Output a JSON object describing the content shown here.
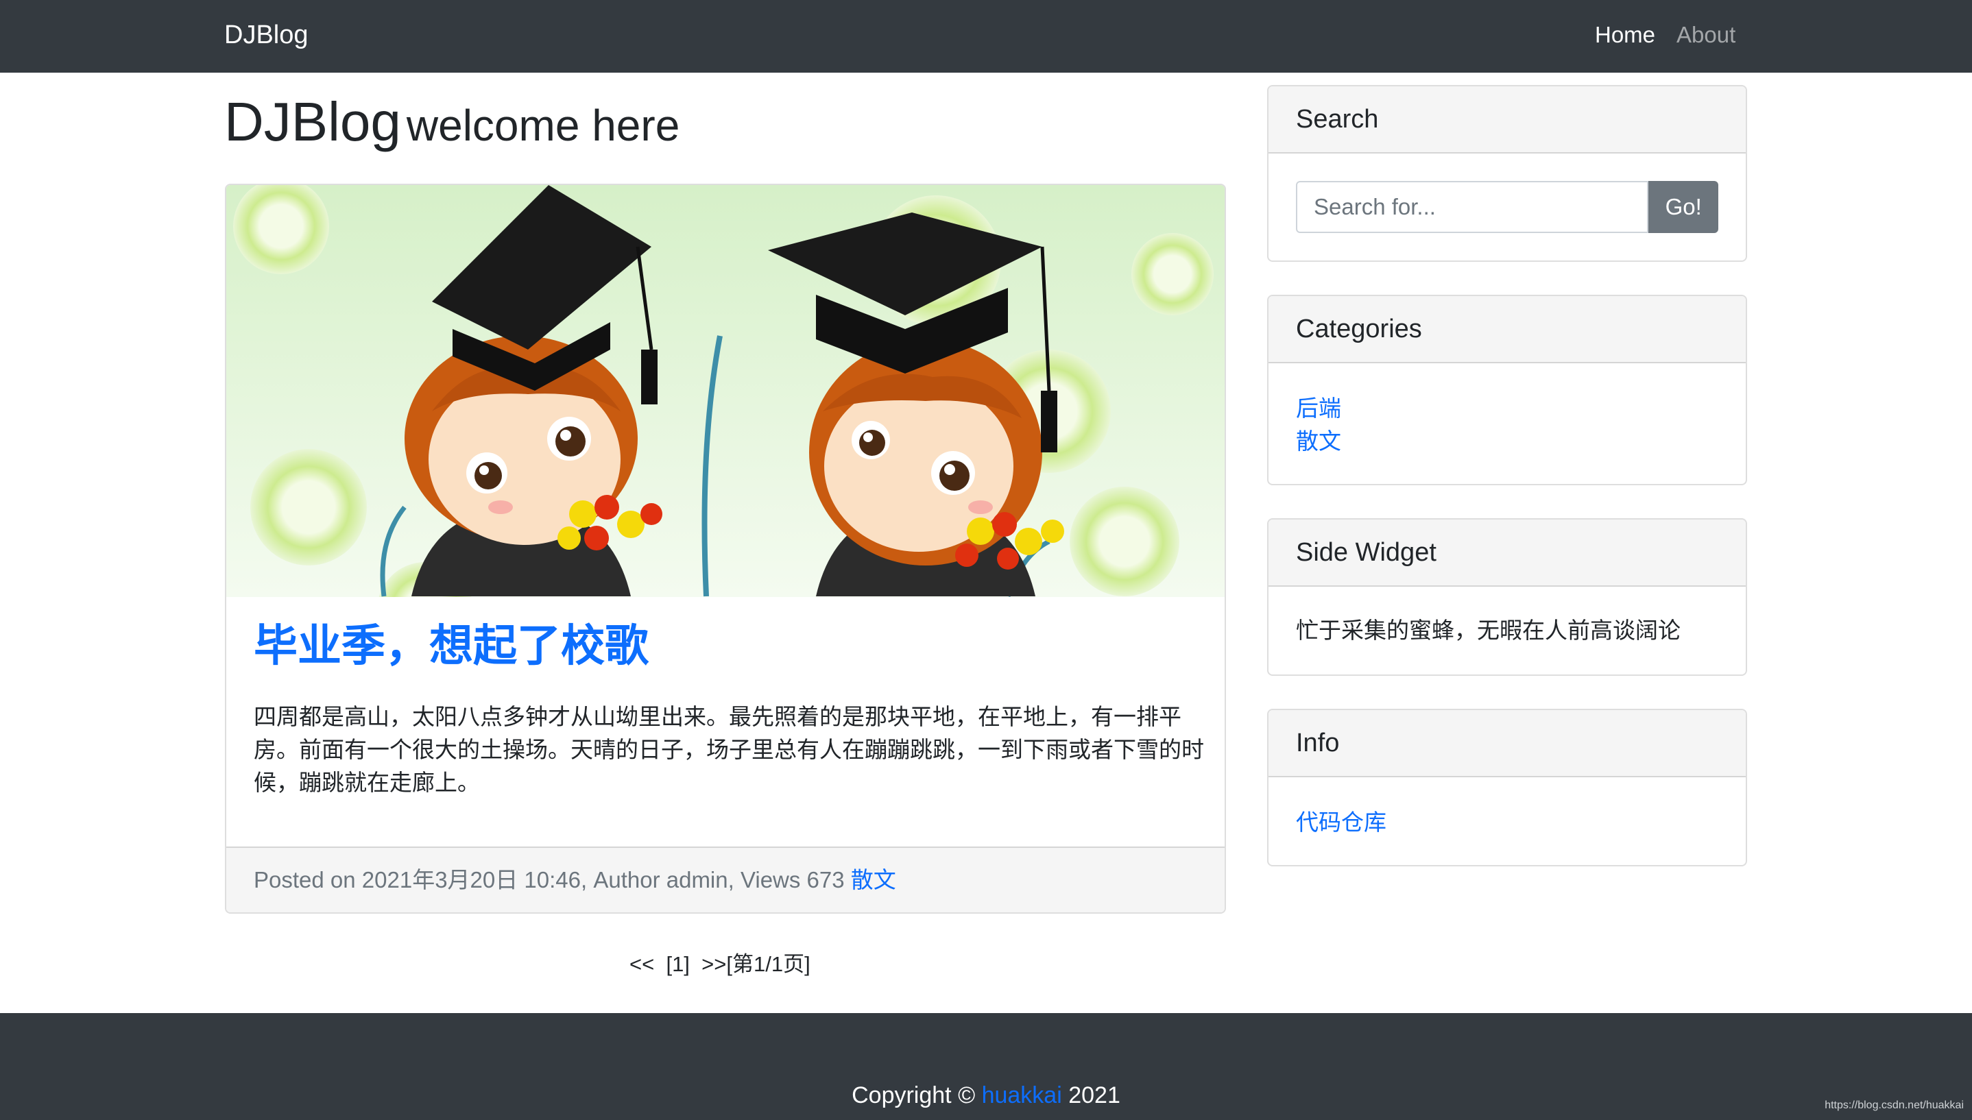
{
  "nav": {
    "brand": "DJBlog",
    "home": "Home",
    "about": "About"
  },
  "heading": {
    "title": "DJBlog",
    "subtitle": "welcome here"
  },
  "post": {
    "title": "毕业季，想起了校歌",
    "excerpt": "四周都是高山，太阳八点多钟才从山坳里出来。最先照着的是那块平地，在平地上，有一排平房。前面有一个很大的土操场。天晴的日子，场子里总有人在蹦蹦跳跳，一到下雨或者下雪的时候，蹦跳就在走廊上。",
    "meta_prefix": "Posted on 2021年3月20日 10:46, Author admin, Views 673",
    "category_link": "散文"
  },
  "pagination": {
    "prev": "<<",
    "current": "[1]",
    "next": ">>[第1/1页]"
  },
  "sidebar": {
    "search": {
      "title": "Search",
      "placeholder": "Search for...",
      "button": "Go!"
    },
    "categories": {
      "title": "Categories",
      "items": [
        "后端",
        "散文"
      ]
    },
    "side_widget": {
      "title": "Side Widget",
      "text": "忙于采集的蜜蜂，无暇在人前高谈阔论"
    },
    "info": {
      "title": "Info",
      "link": "代码仓库"
    }
  },
  "footer": {
    "copyright_prefix": "Copyright ©",
    "author_link": "huakkai",
    "year": "2021"
  },
  "watermark": "https://blog.csdn.net/huakkai",
  "colors": {
    "navbar_bg": "#343a40",
    "link": "#0d6efd",
    "button_bg": "#6c757d",
    "card_header_bg": "#f5f5f5"
  }
}
